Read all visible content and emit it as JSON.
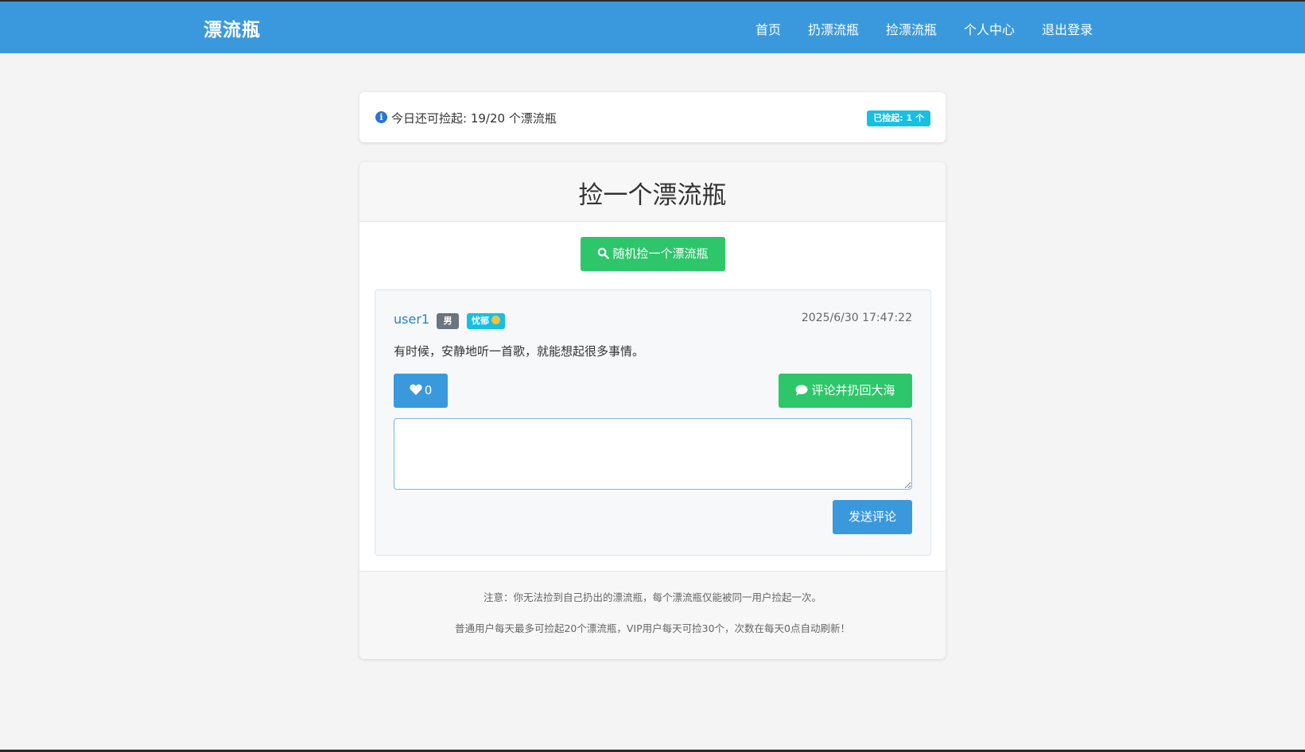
{
  "navbar": {
    "brand": "漂流瓶",
    "links": [
      "首页",
      "扔漂流瓶",
      "捡漂流瓶",
      "个人中心",
      "退出登录"
    ]
  },
  "quota": {
    "text": "今日还可捡起: 19/20 个漂流瓶",
    "picked_badge": "已捡起: 1 个",
    "icon": "info-icon"
  },
  "main": {
    "title": "捡一个漂流瓶",
    "random_button": "随机捡一个漂流瓶",
    "random_icon": "search-icon"
  },
  "bottle": {
    "username": "user1",
    "gender": "男",
    "mood": "忧郁",
    "timestamp": "2025/6/30 17:47:22",
    "content": "有时候，安静地听一首歌，就能想起很多事情。",
    "likes": "0",
    "comment_button": "评论并扔回大海",
    "comment_value": "",
    "send_button": "发送评论"
  },
  "footer": {
    "note1": "注意：你无法捡到自己扔出的漂流瓶，每个漂流瓶仅能被同一用户捡起一次。",
    "note2": "普通用户每天最多可捡起20个漂流瓶，VIP用户每天可捡30个，次数在每天0点自动刷新！"
  },
  "colors": {
    "primary": "#3a99dc",
    "success": "#2ec66a",
    "info_badge": "#15c0e4",
    "secondary_badge": "#6c757d",
    "link": "#2c7fc9",
    "background": "#f4f4f4"
  }
}
